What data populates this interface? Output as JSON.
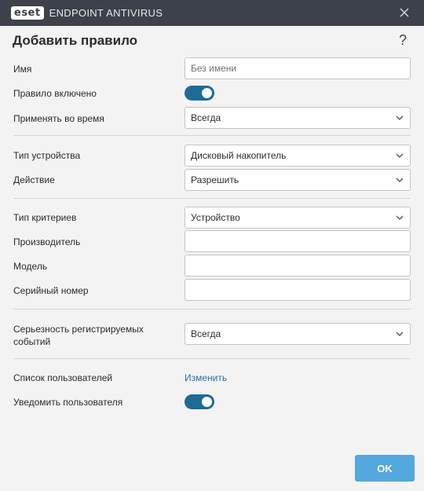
{
  "titlebar": {
    "logo_text": "eset",
    "product_name": "ENDPOINT ANTIVIRUS"
  },
  "dialog": {
    "title": "Добавить правило",
    "help": "?"
  },
  "form": {
    "name": {
      "label": "Имя",
      "value": "",
      "placeholder": "Без имени"
    },
    "enabled": {
      "label": "Правило включено",
      "on": true
    },
    "apply_time": {
      "label": "Применять во время",
      "value": "Всегда"
    },
    "device_type": {
      "label": "Тип устройства",
      "value": "Дисковый накопитель"
    },
    "action": {
      "label": "Действие",
      "value": "Разрешить"
    },
    "criteria_type": {
      "label": "Тип критериев",
      "value": "Устройство"
    },
    "vendor": {
      "label": "Производитель",
      "value": ""
    },
    "model": {
      "label": "Модель",
      "value": ""
    },
    "serial": {
      "label": "Серийный номер",
      "value": ""
    },
    "log_severity": {
      "label_line1": "Серьезность регистрируемых",
      "label_line2": "событий",
      "value": "Всегда"
    },
    "user_list": {
      "label": "Список пользователей",
      "link": "Изменить"
    },
    "notify_user": {
      "label": "Уведомить пользователя",
      "on": true
    }
  },
  "footer": {
    "ok_label": "OK"
  },
  "colors": {
    "titlebar_bg": "#3d4149",
    "toggle_on": "#1e6b95",
    "link": "#2a6fa1",
    "ok_button": "#53a8de"
  },
  "icons": {
    "close": "close-icon",
    "chevron": "chevron-down-icon"
  }
}
